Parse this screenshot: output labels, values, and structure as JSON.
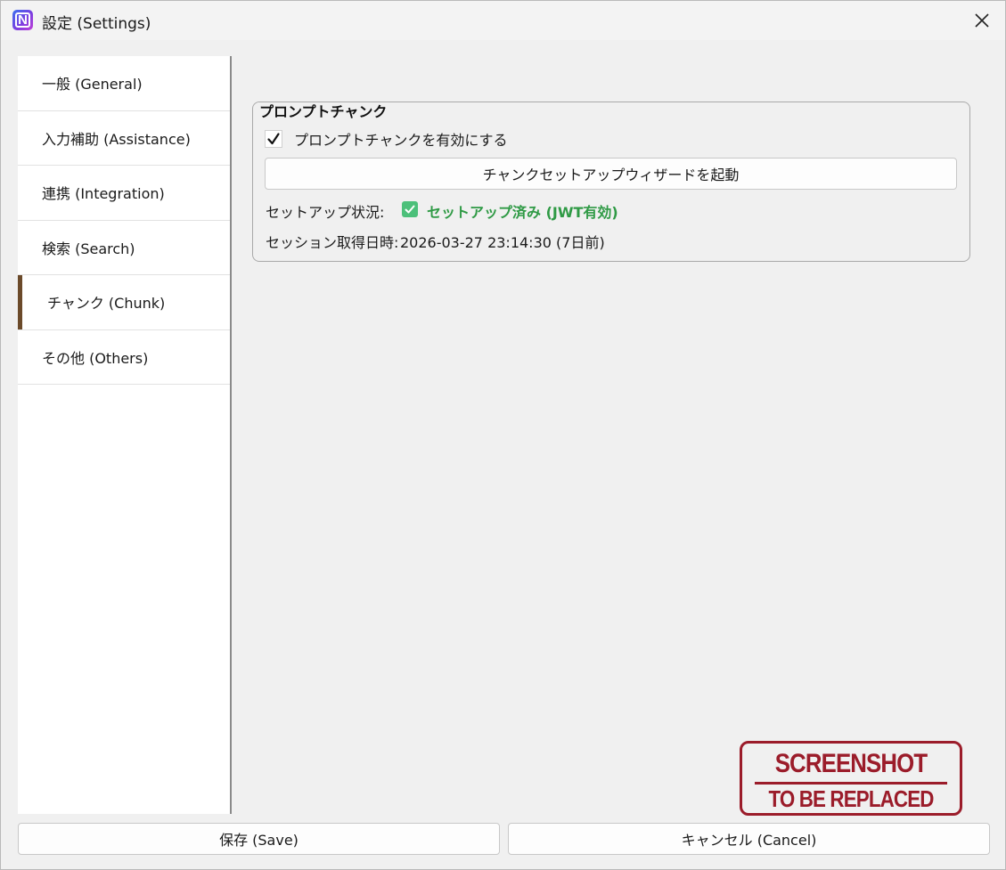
{
  "window": {
    "title": "設定 (Settings)",
    "app_icon_letter": "N",
    "close_icon": "close-icon"
  },
  "sidebar": {
    "items": [
      {
        "label": "一般 (General)",
        "active": false
      },
      {
        "label": "入力補助 (Assistance)",
        "active": false
      },
      {
        "label": "連携 (Integration)",
        "active": false
      },
      {
        "label": "検索 (Search)",
        "active": false
      },
      {
        "label": "チャンク (Chunk)",
        "active": true
      },
      {
        "label": "その他 (Others)",
        "active": false
      }
    ],
    "active_color": "#6b4a2a"
  },
  "chunk": {
    "group_title": "プロンプトチャンク",
    "enable_label": "プロンプトチャンクを有効にする",
    "enable_checked": true,
    "wizard_button": "チャンクセットアップウィザードを起動",
    "status_label": "セットアップ状況:",
    "status_value": "セットアップ済み (JWT有効)",
    "status_color": "#2f9a45",
    "session_label": "セッション取得日時:",
    "session_value": "2026-03-27 23:14:30 (7日前)"
  },
  "stamp": {
    "line1": "SCREENSHOT",
    "line2": "TO BE REPLACED"
  },
  "footer": {
    "save_label": "保存 (Save)",
    "cancel_label": "キャンセル (Cancel)"
  }
}
